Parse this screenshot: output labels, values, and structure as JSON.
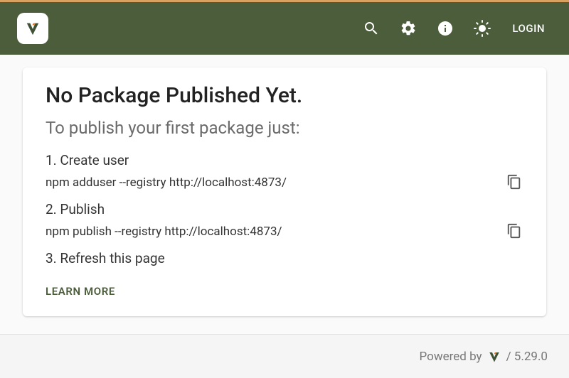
{
  "header": {
    "login_label": "LOGIN"
  },
  "card": {
    "title": "No Package Published Yet.",
    "subtitle": "To publish your first package just:",
    "steps": {
      "s1_label": "1. Create user",
      "s1_cmd": "npm adduser --registry http://localhost:4873/",
      "s2_label": "2. Publish",
      "s2_cmd": "npm publish --registry http://localhost:4873/",
      "s3_label": "3. Refresh this page"
    },
    "learn_more": "LEARN MORE"
  },
  "footer": {
    "powered_by": "Powered by",
    "version": "/ 5.29.0"
  }
}
